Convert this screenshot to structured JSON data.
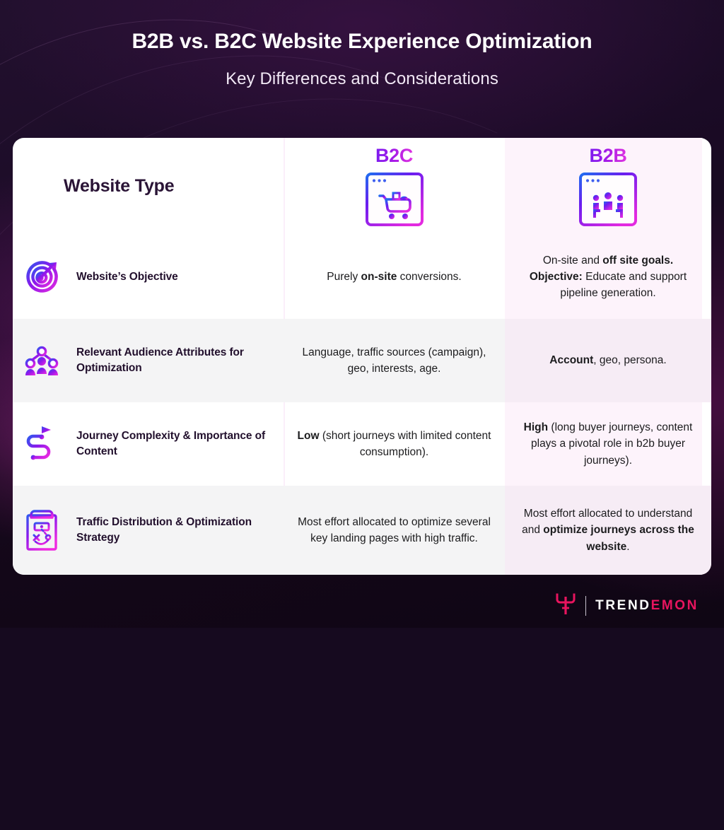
{
  "header": {
    "title": "B2B vs. B2C Website Experience Optimization",
    "subtitle": "Key Differences and Considerations"
  },
  "table": {
    "label_column_header": "Website Type",
    "columns": [
      {
        "key": "b2c",
        "label": "B2C",
        "icon": "browser-shopping-cart-icon"
      },
      {
        "key": "b2b",
        "label": "B2B",
        "icon": "browser-people-meeting-icon"
      }
    ],
    "rows": [
      {
        "icon": "target-arrow-icon",
        "title": "Website’s Objective",
        "b2c": [
          {
            "t": "Purely ",
            "b": false
          },
          {
            "t": "on-site",
            "b": true
          },
          {
            "t": " conversions.",
            "b": false
          }
        ],
        "b2b": [
          {
            "t": "On-site and ",
            "b": false
          },
          {
            "t": "off site goals.",
            "b": true
          },
          {
            "t": " ",
            "b": false
          },
          {
            "t": "Objective:",
            "b": true
          },
          {
            "t": " Educate and support pipeline generation.",
            "b": false
          }
        ]
      },
      {
        "icon": "audience-network-icon",
        "title": "Relevant Audience Attributes for Optimization",
        "b2c": [
          {
            "t": "Language, traffic sources (campaign), geo, interests, age.",
            "b": false
          }
        ],
        "b2b": [
          {
            "t": "Account",
            "b": true
          },
          {
            "t": ", geo, persona.",
            "b": false
          }
        ]
      },
      {
        "icon": "winding-path-flag-icon",
        "title": "Journey Complexity & Importance of Content",
        "b2c": [
          {
            "t": "Low",
            "b": true
          },
          {
            "t": " (short journeys with limited content consumption).",
            "b": false
          }
        ],
        "b2b": [
          {
            "t": "High",
            "b": true
          },
          {
            "t": " (long buyer journeys, content plays a pivotal role in b2b buyer journeys).",
            "b": false
          }
        ]
      },
      {
        "icon": "clipboard-strategy-icon",
        "title": "Traffic Distribution & Optimization Strategy",
        "b2c": [
          {
            "t": "Most effort allocated to optimize several key landing pages with high traffic.",
            "b": false
          }
        ],
        "b2b": [
          {
            "t": "Most effort allocated to understand and ",
            "b": false
          },
          {
            "t": "optimize journeys across the website",
            "b": true
          },
          {
            "t": ".",
            "b": false
          }
        ]
      }
    ]
  },
  "footer": {
    "logo_mark": "trendemon-horns-icon",
    "logo_text_primary": "TREND",
    "logo_text_accent": "EMON"
  },
  "colors": {
    "background_dark": "#160a1f",
    "card_white": "#ffffff",
    "b2b_column": "#fdf3fb",
    "row_shade_left": "#f4f4f5",
    "row_shade_b2b": "#f6ecf5",
    "heading_gradient_start": "#7a1bf0",
    "heading_gradient_end": "#e335e0",
    "title_text": "#ffffff",
    "body_text": "#1c1c1e",
    "label_text": "#22102d",
    "logo_accent": "#e8145e"
  }
}
